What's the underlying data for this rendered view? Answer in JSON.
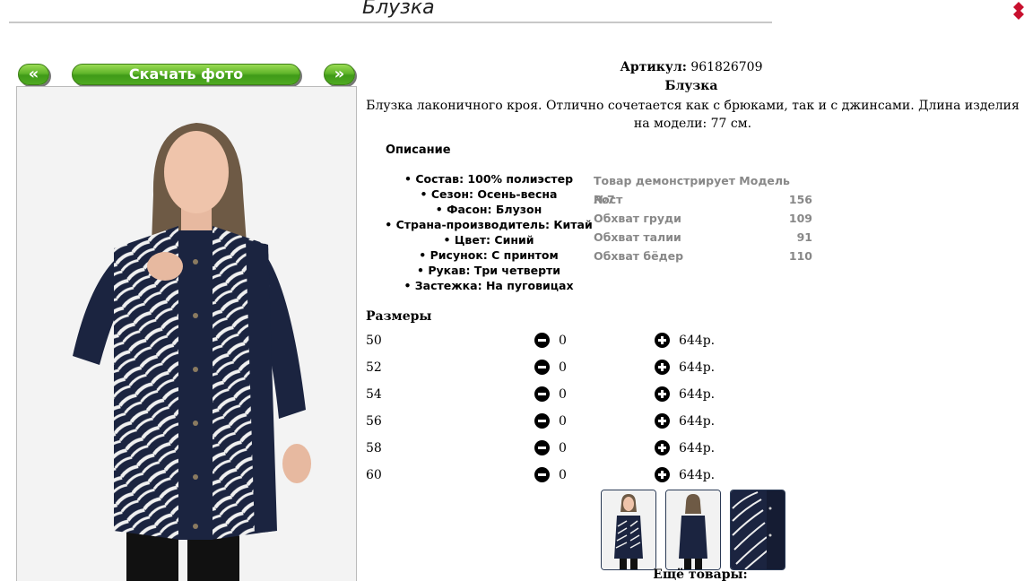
{
  "page": {
    "title": "Блузка"
  },
  "buttons": {
    "prev": "«",
    "download": "Скачать фото",
    "next": "»"
  },
  "product": {
    "sku_label": "Артикул:",
    "sku_value": "961826709",
    "name": "Блузка",
    "description": "Блузка лаконичного кроя. Отлично сочетается как с брюками, так и с джинсами. Длина изделия на модели: 77 см."
  },
  "specs": {
    "heading": "Описание",
    "items": [
      "Состав: 100% полиэстер",
      "Сезон: Осень-весна",
      "Фасон: Блузон",
      "Страна-производитель: Китай",
      "Цвет: Синий",
      "Рисунок: С принтом",
      "Рукав: Три четверти",
      "Застежка: На пуговицах"
    ]
  },
  "model": {
    "rows": [
      {
        "label": "Товар демонстрирует Модель №7",
        "value": ""
      },
      {
        "label": "Рост",
        "value": "156"
      },
      {
        "label": "Обхват груди",
        "value": "109"
      },
      {
        "label": "Обхват талии",
        "value": "91"
      },
      {
        "label": "Обхват бёдер",
        "value": "110"
      }
    ]
  },
  "sizes": {
    "heading": "Размеры",
    "rows": [
      {
        "size": "50",
        "qty": "0",
        "price": "644р."
      },
      {
        "size": "52",
        "qty": "0",
        "price": "644р."
      },
      {
        "size": "54",
        "qty": "0",
        "price": "644р."
      },
      {
        "size": "56",
        "qty": "0",
        "price": "644р."
      },
      {
        "size": "58",
        "qty": "0",
        "price": "644р."
      },
      {
        "size": "60",
        "qty": "0",
        "price": "644р."
      }
    ]
  },
  "more": {
    "label": "Ещё товары:"
  },
  "colors": {
    "button_green": "#4faa21",
    "shirt_navy": "#1b2440",
    "model_gray": "#888888"
  }
}
